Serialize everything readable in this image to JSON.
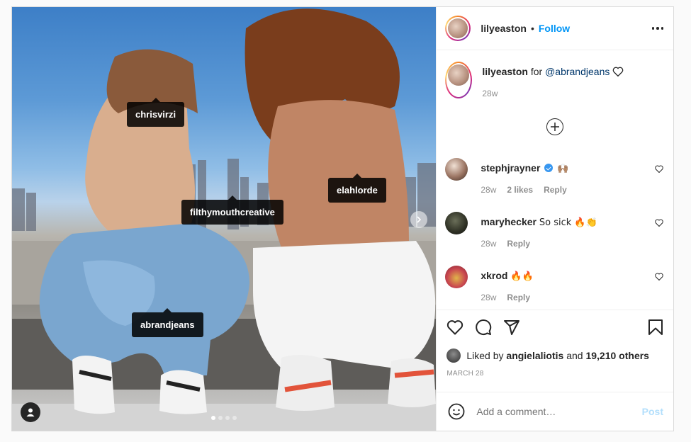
{
  "post": {
    "author": "lilyeaston",
    "follow_label": "Follow",
    "separator": "•"
  },
  "media": {
    "tags": [
      {
        "label": "chrisvirzi"
      },
      {
        "label": "filthymouthcreative"
      },
      {
        "label": "elahlorde"
      },
      {
        "label": "abrandjeans"
      }
    ],
    "carousel_dots": 4,
    "active_dot": 0
  },
  "caption": {
    "user": "lilyeaston",
    "text": "for",
    "mention": "@abrandjeans",
    "time": "28w"
  },
  "comments": [
    {
      "user": "stephjrayner",
      "verified": true,
      "text": "🙌🏽",
      "time": "28w",
      "likes": "2 likes",
      "reply": "Reply"
    },
    {
      "user": "maryhecker",
      "verified": false,
      "text": "So sick 🔥👏",
      "time": "28w",
      "likes": "",
      "reply": "Reply"
    },
    {
      "user": "xkrod",
      "verified": false,
      "text": "🔥🔥",
      "time": "28w",
      "likes": "",
      "reply": "Reply"
    }
  ],
  "likes": {
    "prefix": "Liked by",
    "user": "angielaliotis",
    "and": "and",
    "count": "19,210 others"
  },
  "date": "MARCH 28",
  "composer": {
    "placeholder": "Add a comment…",
    "post_label": "Post"
  },
  "icons": [
    "heart-icon",
    "comment-icon",
    "share-icon",
    "bookmark-icon",
    "emoji-icon",
    "more-icon",
    "plus-circle-icon",
    "chevron-right-icon",
    "user-tag-icon"
  ]
}
